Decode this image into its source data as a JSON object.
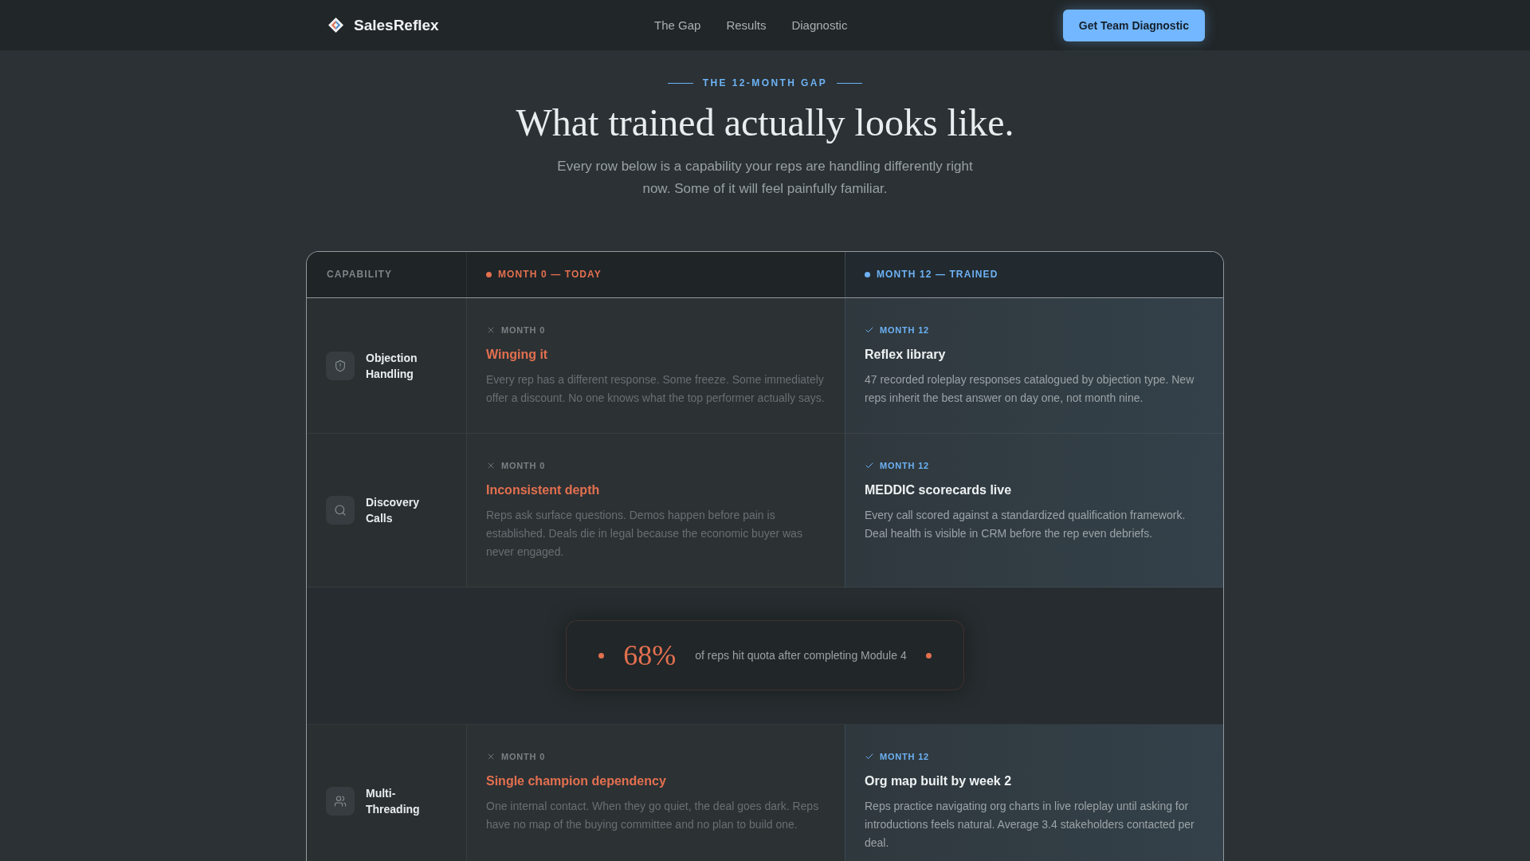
{
  "nav": {
    "brand": "SalesReflex",
    "links": [
      {
        "label": "The Gap"
      },
      {
        "label": "Results"
      },
      {
        "label": "Diagnostic"
      }
    ],
    "cta": "Get Team Diagnostic"
  },
  "intro": {
    "eyebrow": "THE 12-MONTH GAP",
    "title": "What trained actually looks like.",
    "subtitle": "Every row below is a capability your reps are handling differently right now. Some of it will feel painfully familiar."
  },
  "table": {
    "columns": [
      {
        "label": "CAPABILITY"
      },
      {
        "label": "MONTH 0 — TODAY",
        "color": "#e3704f"
      },
      {
        "label": "MONTH 12 — TRAINED",
        "color": "#6db2f5"
      }
    ],
    "rows": [
      {
        "kind": "capability",
        "name": "Objection Handling",
        "today": {
          "label": "MONTH 0",
          "title": "Winging it",
          "text": "Every rep has a different response. Some freeze. Some immediately offer a discount. No one knows what the top performer actually says."
        },
        "trained": {
          "label": "MONTH 12",
          "title": "Reflex library",
          "text": "47 recorded roleplay responses catalogued by objection type. New reps inherit the best answer on day one, not month nine."
        }
      },
      {
        "kind": "capability",
        "name": "Discovery Calls",
        "today": {
          "label": "MONTH 0",
          "title": "Inconsistent depth",
          "text": "Reps ask surface questions. Demos happen before pain is established. Deals die in legal because the economic buyer was never engaged."
        },
        "trained": {
          "label": "MONTH 12",
          "title": "MEDDIC scorecards live",
          "text": "Every call scored against a standardized qualification framework. Deal health is visible in CRM before the rep even debriefs."
        }
      },
      {
        "kind": "stat",
        "value": "68%",
        "text": "of reps hit quota after completing Module 4"
      },
      {
        "kind": "capability",
        "name": "Multi-Threading",
        "today": {
          "label": "MONTH 0",
          "title": "Single champion dependency",
          "text": "One internal contact. When they go quiet, the deal goes dark. Reps have no map of the buying committee and no plan to build one."
        },
        "trained": {
          "label": "MONTH 12",
          "title": "Org map built by week 2",
          "text": "Reps practice navigating org charts in live roleplay until asking for introductions feels natural. Average 3.4 stakeholders contacted per deal."
        }
      }
    ]
  }
}
